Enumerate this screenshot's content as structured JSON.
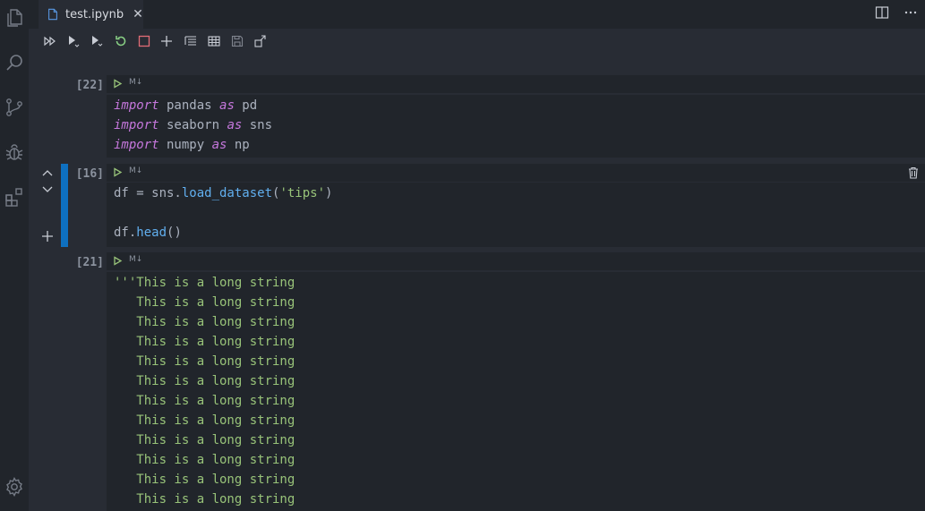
{
  "tab": {
    "label": "test.ipynb",
    "close": "✕"
  },
  "cells": [
    {
      "execution_count": "[22]",
      "language_tag": "M↓",
      "lines": [
        {
          "kw1": "import",
          "t1": " pandas ",
          "kw2": "as",
          "t2": " pd"
        },
        {
          "kw1": "import",
          "t1": " seaborn ",
          "kw2": "as",
          "t2": " sns"
        },
        {
          "kw1": "import",
          "t1": " numpy ",
          "kw2": "as",
          "t2": " np"
        }
      ]
    },
    {
      "execution_count": "[16]",
      "language_tag": "M↓",
      "line1": {
        "a": "df = sns.",
        "fn": "load_dataset",
        "b": "(",
        "str": "'tips'",
        "c": ")"
      },
      "line2": {
        "a": "df.",
        "fn": "head",
        "b": "()"
      }
    },
    {
      "execution_count": "[21]",
      "language_tag": "M↓",
      "lines": [
        "'''This is a long string",
        "   This is a long string",
        "   This is a long string",
        "   This is a long string",
        "   This is a long string",
        "   This is a long string",
        "   This is a long string",
        "   This is a long string",
        "   This is a long string",
        "   This is a long string",
        "   This is a long string",
        "   This is a long string"
      ]
    }
  ],
  "colors": {
    "accent": "#0e70c0",
    "run_green": "#98c379",
    "keyword": "#c678dd",
    "function": "#61afef",
    "string": "#98c379"
  },
  "icons": {
    "activity_bar": [
      "explorer-icon",
      "search-icon",
      "source-control-icon",
      "debug-icon",
      "extensions-icon",
      "settings-gear-icon"
    ],
    "toolbar": [
      "run-all-icon",
      "run-above-icon",
      "run-below-icon",
      "restart-icon",
      "interrupt-icon",
      "add-cell-icon",
      "clear-outputs-icon",
      "variables-icon",
      "save-icon",
      "export-icon"
    ]
  }
}
